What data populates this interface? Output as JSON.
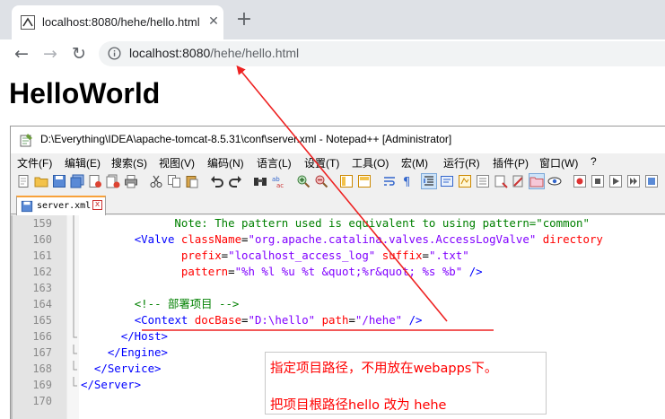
{
  "browser": {
    "tab_title": "localhost:8080/hehe/hello.html",
    "tab_close": "✕",
    "new_tab": "+",
    "url_host": "localhost:8080",
    "url_path": "/hehe/hello.html",
    "back": "←",
    "forward": "→",
    "reload": "↻"
  },
  "page": {
    "heading": "HelloWorld"
  },
  "notepad": {
    "title": "D:\\Everything\\IDEA\\apache-tomcat-8.5.31\\conf\\server.xml - Notepad++ [Administrator]",
    "menu": [
      "文件(F)",
      "编辑(E)",
      "搜索(S)",
      "视图(V)",
      "编码(N)",
      "语言(L)",
      "设置(T)",
      "工具(O)",
      "宏(M)",
      "运行(R)",
      "插件(P)",
      "窗口(W)",
      "?"
    ],
    "file_tab": "server.xml",
    "file_close": "x",
    "lines": [
      {
        "n": "159",
        "segs": [
          {
            "c": "c-cmt",
            "t": "              Note: The pattern used is equivalent to using pattern=\"common\""
          }
        ]
      },
      {
        "n": "160",
        "segs": [
          {
            "c": "c-txt",
            "t": "        "
          },
          {
            "c": "c-tag",
            "t": "<Valve "
          },
          {
            "c": "c-attr",
            "t": "className"
          },
          {
            "c": "c-txt",
            "t": "="
          },
          {
            "c": "c-val",
            "t": "\"org.apache.catalina.valves.AccessLogValve\""
          },
          {
            "c": "c-attr",
            "t": " directory"
          }
        ]
      },
      {
        "n": "161",
        "segs": [
          {
            "c": "c-txt",
            "t": "               "
          },
          {
            "c": "c-attr",
            "t": "prefix"
          },
          {
            "c": "c-txt",
            "t": "="
          },
          {
            "c": "c-val",
            "t": "\"localhost_access_log\""
          },
          {
            "c": "c-attr",
            "t": " suffix"
          },
          {
            "c": "c-txt",
            "t": "="
          },
          {
            "c": "c-val",
            "t": "\".txt\""
          }
        ]
      },
      {
        "n": "162",
        "segs": [
          {
            "c": "c-txt",
            "t": "               "
          },
          {
            "c": "c-attr",
            "t": "pattern"
          },
          {
            "c": "c-txt",
            "t": "="
          },
          {
            "c": "c-val",
            "t": "\"%h %l %u %t &quot;%r&quot; %s %b\""
          },
          {
            "c": "c-tag",
            "t": " />"
          }
        ]
      },
      {
        "n": "163",
        "segs": []
      },
      {
        "n": "164",
        "segs": [
          {
            "c": "c-txt",
            "t": "        "
          },
          {
            "c": "c-cmt",
            "t": "<!-- 部署项目 -->"
          }
        ]
      },
      {
        "n": "165",
        "segs": [
          {
            "c": "c-txt",
            "t": "        "
          },
          {
            "c": "c-tag",
            "t": "<Context "
          },
          {
            "c": "c-attr",
            "t": "docBase"
          },
          {
            "c": "c-txt",
            "t": "="
          },
          {
            "c": "c-val",
            "t": "\"D:\\hello\""
          },
          {
            "c": "c-attr",
            "t": " path"
          },
          {
            "c": "c-txt",
            "t": "="
          },
          {
            "c": "c-val",
            "t": "\"/hehe\""
          },
          {
            "c": "c-tag",
            "t": " />"
          }
        ]
      },
      {
        "n": "166",
        "segs": [
          {
            "c": "c-txt",
            "t": "      "
          },
          {
            "c": "c-tag",
            "t": "</Host>"
          }
        ]
      },
      {
        "n": "167",
        "segs": [
          {
            "c": "c-txt",
            "t": "    "
          },
          {
            "c": "c-tag",
            "t": "</Engine>"
          }
        ]
      },
      {
        "n": "168",
        "segs": [
          {
            "c": "c-txt",
            "t": "  "
          },
          {
            "c": "c-tag",
            "t": "</Service>"
          }
        ]
      },
      {
        "n": "169",
        "segs": [
          {
            "c": "c-tag",
            "t": "</Server>"
          }
        ]
      },
      {
        "n": "170",
        "segs": []
      }
    ]
  },
  "annotation": {
    "line1": "指定项目路径，不用放在webapps下。",
    "line2": "把项目根路径hello 改为 hehe",
    "color": "#ff0000"
  }
}
